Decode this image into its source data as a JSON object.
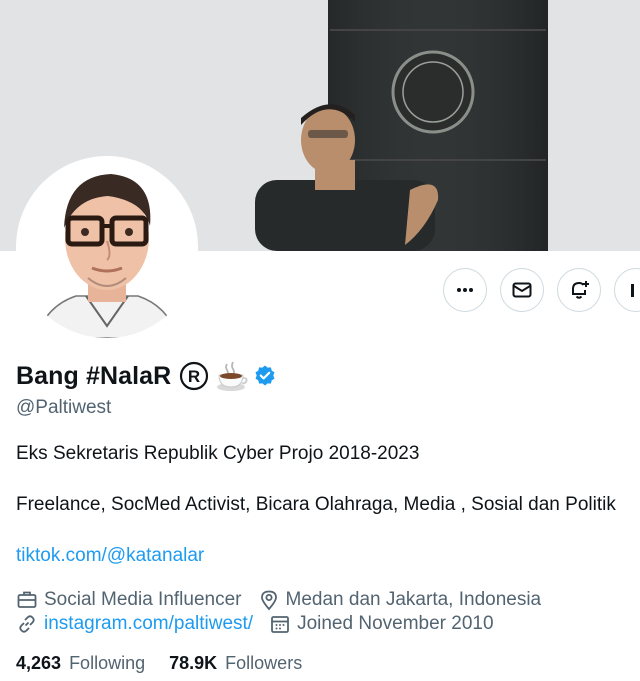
{
  "profile": {
    "display_name": "Bang #NalaR",
    "registered_mark": "®",
    "handle": "@Paltiwest",
    "verified": true,
    "bio_line1": "Eks Sekretaris Republik Cyber Projo 2018-2023",
    "bio_line2": "Freelance, SocMed Activist, Bicara Olahraga, Media , Sosial dan Politik",
    "bio_link": "tiktok.com/@katanalar",
    "category": "Social Media Influencer",
    "location": "Medan dan Jakarta, Indonesia",
    "website": "instagram.com/paltiwest/",
    "joined": "Joined November 2010",
    "following_count": "4,263",
    "following_label": "Following",
    "followers_count": "78.9K",
    "followers_label": "Followers"
  },
  "actions": {
    "more_icon": "more-horizontal-icon",
    "message_icon": "envelope-icon",
    "notify_icon": "bell-plus-icon",
    "follow_partial": "follow-button"
  },
  "colors": {
    "accent": "#1d9bf0",
    "text_primary": "#0f1419",
    "text_secondary": "#536471",
    "border": "#cfd9de"
  }
}
